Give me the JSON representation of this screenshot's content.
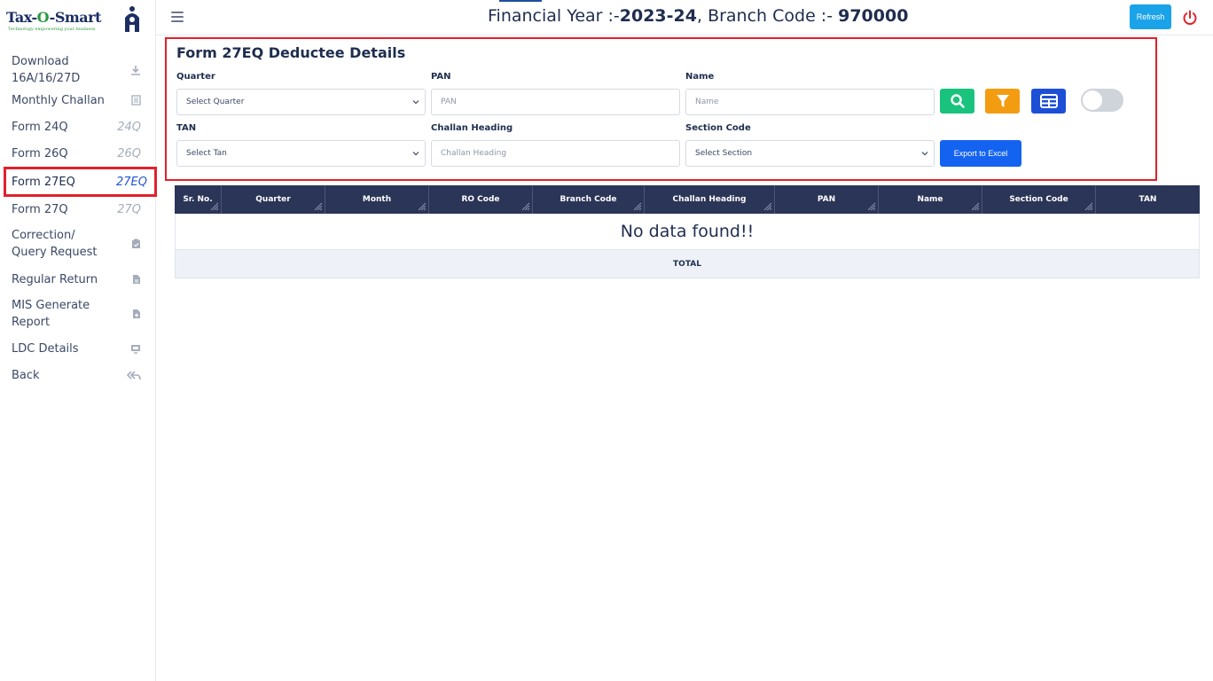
{
  "brand": {
    "name_part1": "Tax-",
    "name_part2": "O",
    "name_part3": "-Smart",
    "tagline": "Technology empowering your business"
  },
  "sidebar": {
    "items": [
      {
        "label": "Download 16A/16/27D",
        "icon": "download-icon",
        "icon_text": ""
      },
      {
        "label": "Monthly Challan",
        "icon": "document-icon",
        "icon_text": ""
      },
      {
        "label": "Form 24Q",
        "icon": "text-icon",
        "icon_text": "24Q"
      },
      {
        "label": "Form 26Q",
        "icon": "text-icon",
        "icon_text": "26Q"
      },
      {
        "label": "Form 27EQ",
        "icon": "text-icon",
        "icon_text": "27EQ"
      },
      {
        "label": "Form 27Q",
        "icon": "text-icon",
        "icon_text": "27Q"
      },
      {
        "label": "Correction/ Query Request",
        "icon": "clipboard-icon",
        "icon_text": ""
      },
      {
        "label": "Regular Return",
        "icon": "file-icon",
        "icon_text": ""
      },
      {
        "label": "MIS Generate Report",
        "icon": "file-add-icon",
        "icon_text": ""
      },
      {
        "label": "LDC Details",
        "icon": "monitor-icon",
        "icon_text": ""
      },
      {
        "label": "Back",
        "icon": "reply-all-icon",
        "icon_text": ""
      }
    ],
    "active_index": 4
  },
  "header": {
    "fy_prefix": "Financial Year :-",
    "fy_value": "2023-24",
    "branch_prefix": ", Branch Code :- ",
    "branch_value": "970000",
    "refresh_label": "Refresh"
  },
  "form": {
    "title": "Form 27EQ Deductee Details",
    "quarter": {
      "label": "Quarter",
      "value": "Select Quarter"
    },
    "pan": {
      "label": "PAN",
      "placeholder": "PAN"
    },
    "name": {
      "label": "Name",
      "placeholder": "Name"
    },
    "tan": {
      "label": "TAN",
      "value": "Select Tan"
    },
    "challan": {
      "label": "Challan Heading",
      "placeholder": "Challan Heading"
    },
    "section": {
      "label": "Section Code",
      "value": "Select Section"
    },
    "export_label": "Export to Excel"
  },
  "colors": {
    "search_button": "#19c37d",
    "filter_button": "#f39c12",
    "grid_button": "#1d4fd6",
    "accent_red": "#e1212c"
  },
  "table": {
    "columns": [
      "Sr. No.",
      "Quarter",
      "Month",
      "RO Code",
      "Branch Code",
      "Challan Heading",
      "PAN",
      "Name",
      "Section Code",
      "TAN"
    ],
    "empty_message": "No data found!!",
    "total_label": "TOTAL"
  }
}
